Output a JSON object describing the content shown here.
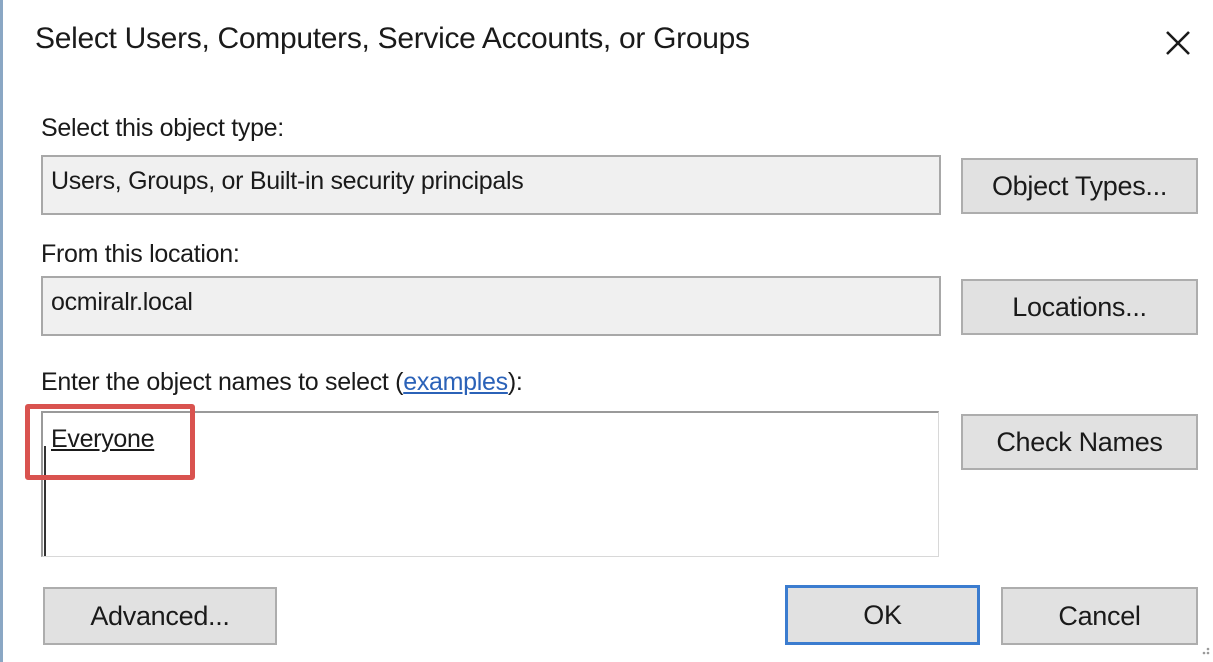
{
  "dialog": {
    "title": "Select Users, Computers, Service Accounts, or Groups"
  },
  "object_type": {
    "label": "Select this object type:",
    "value": "Users, Groups, or Built-in security principals",
    "button_label": "Object Types..."
  },
  "location": {
    "label": "From this location:",
    "value": "ocmiralr.local",
    "button_label": "Locations..."
  },
  "object_names": {
    "label_prefix": "Enter the object names to select (",
    "label_link": "examples",
    "label_suffix": "):",
    "value": "Everyone",
    "button_label": "Check Names"
  },
  "footer": {
    "advanced_label": "Advanced...",
    "ok_label": "OK",
    "cancel_label": "Cancel"
  },
  "annotation": {
    "highlight_color": "#d9534f"
  },
  "colors": {
    "accent_border": "#3b7ccf",
    "link": "#2b62b8"
  },
  "icons": {
    "close": "close-icon",
    "grip": "resize-grip-icon"
  }
}
